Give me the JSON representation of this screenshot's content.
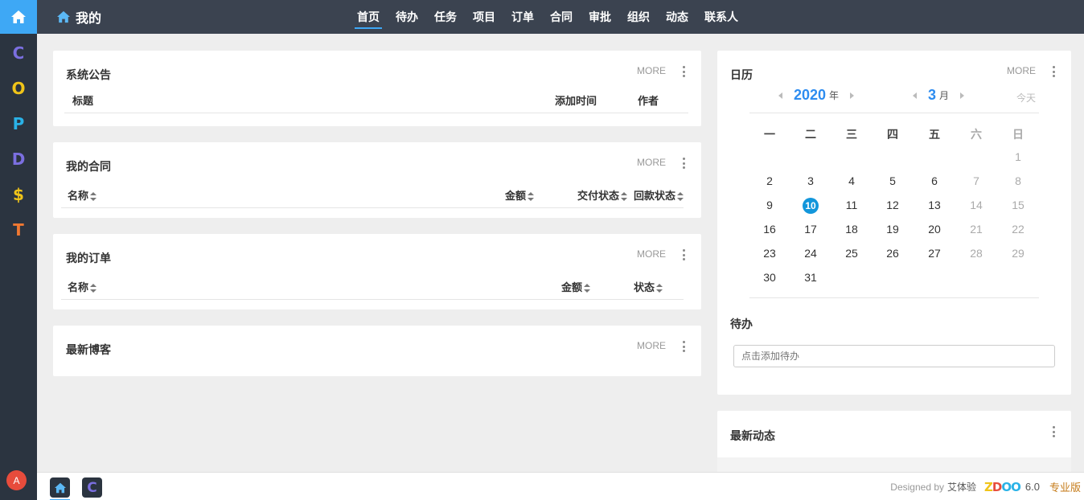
{
  "rail": {
    "letters": [
      {
        "text": "C",
        "color": "#7b6fe0"
      },
      {
        "text": "O",
        "color": "#f0c419"
      },
      {
        "text": "P",
        "color": "#2ab2e7"
      },
      {
        "text": "D",
        "color": "#7b6fe0"
      },
      {
        "text": "$",
        "color": "#f0c419"
      },
      {
        "text": "T",
        "color": "#f07832"
      }
    ],
    "avatar": "A"
  },
  "header": {
    "title": "我的",
    "nav": [
      "首页",
      "待办",
      "任务",
      "项目",
      "订单",
      "合同",
      "审批",
      "组织",
      "动态",
      "联系人"
    ],
    "active_index": 0
  },
  "common": {
    "more": "MORE"
  },
  "announcements": {
    "title": "系统公告",
    "columns": [
      "标题",
      "添加时间",
      "作者"
    ]
  },
  "contracts": {
    "title": "我的合同",
    "columns": [
      "名称",
      "金额",
      "交付状态",
      "回款状态"
    ]
  },
  "orders": {
    "title": "我的订单",
    "columns": [
      "名称",
      "金额",
      "状态"
    ]
  },
  "blog": {
    "title": "最新博客"
  },
  "calendar": {
    "title": "日历",
    "year": "2020",
    "year_unit": "年",
    "month": "3",
    "month_unit": "月",
    "today": "今天",
    "weekdays": [
      "一",
      "二",
      "三",
      "四",
      "五",
      "六",
      "日"
    ],
    "selected_day": 10,
    "weeks": [
      [
        "",
        "",
        "",
        "",
        "",
        "",
        "1"
      ],
      [
        "2",
        "3",
        "4",
        "5",
        "6",
        "7",
        "8"
      ],
      [
        "9",
        "10",
        "11",
        "12",
        "13",
        "14",
        "15"
      ],
      [
        "16",
        "17",
        "18",
        "19",
        "20",
        "21",
        "22"
      ],
      [
        "23",
        "24",
        "25",
        "26",
        "27",
        "28",
        "29"
      ],
      [
        "30",
        "31",
        "",
        "",
        "",
        "",
        ""
      ]
    ]
  },
  "todo": {
    "title": "待办",
    "placeholder": "点击添加待办"
  },
  "dynamics": {
    "title": "最新动态"
  },
  "footer": {
    "designed_by": "Designed by",
    "brand": "艾体验",
    "version": "6.0",
    "edition": "专业版",
    "edition_color": "#c57a17"
  },
  "colors": {
    "accent": "#3ea8f5",
    "header_bg": "#3b4350",
    "rail_bg": "#2b3440"
  }
}
